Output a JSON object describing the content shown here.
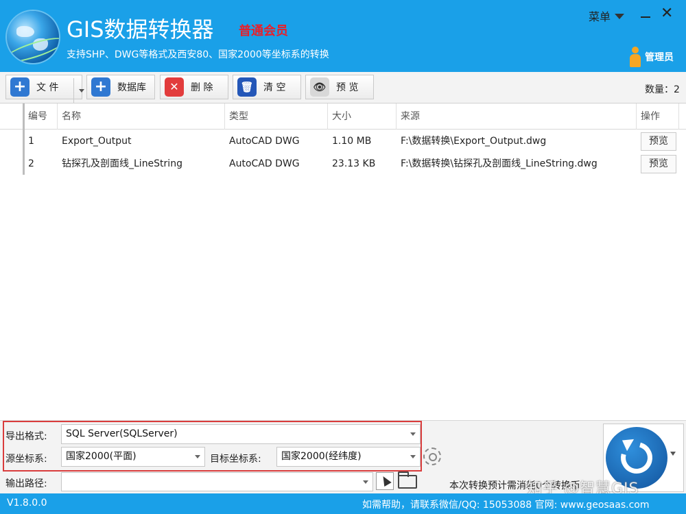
{
  "header": {
    "app_title": "GIS数据转换器",
    "membership": "普通会员",
    "subtitle": "支持SHP、DWG等格式及西安80、国家2000等坐标系的转换",
    "menu_label": "菜单",
    "user_label": "管理员",
    "close_glyph": "✕"
  },
  "toolbar": {
    "file_label": "文 件",
    "database_label": "数据库",
    "delete_label": "删 除",
    "clear_label": "清 空",
    "preview_label": "预 览",
    "count_label": "数量：2",
    "add_glyph": "+",
    "delete_glyph": "✕",
    "clear_glyph": "🗑",
    "preview_glyph": "👁"
  },
  "table": {
    "columns": [
      "编号",
      "名称",
      "类型",
      "大小",
      "来源",
      "操作"
    ],
    "rows": [
      {
        "id": "1",
        "name": "Export_Output",
        "type": "AutoCAD DWG",
        "size": "1.10 MB",
        "source": "F:\\数据转换\\Export_Output.dwg",
        "action": "预览"
      },
      {
        "id": "2",
        "name": "钻探孔及剖面线_LineString",
        "type": "AutoCAD DWG",
        "size": "23.13 KB",
        "source": "F:\\数据转换\\钻探孔及剖面线_LineString.dwg",
        "action": "预览"
      }
    ]
  },
  "panel": {
    "export_format_label": "导出格式:",
    "export_format_value": "SQL Server(SQLServer)",
    "source_crs_label": "源坐标系:",
    "source_crs_value": "国家2000(平面)",
    "target_crs_label": "目标坐标系:",
    "target_crs_value": "国家2000(经纬度)",
    "output_path_label": "输出路径:",
    "output_path_value": "",
    "estimate_text": "本次转换预计需消耗0个转换币"
  },
  "watermark": "知乎 @智慧GIS",
  "status": {
    "version": "V1.8.0.0",
    "contact": "如需帮助，请联系微信/QQ:  15053088  官网:  www.geosaas.com"
  },
  "colors": {
    "brand_blue": "#1aa0e8",
    "member_red": "#e8202a",
    "highlight_red": "#d93c3c"
  }
}
